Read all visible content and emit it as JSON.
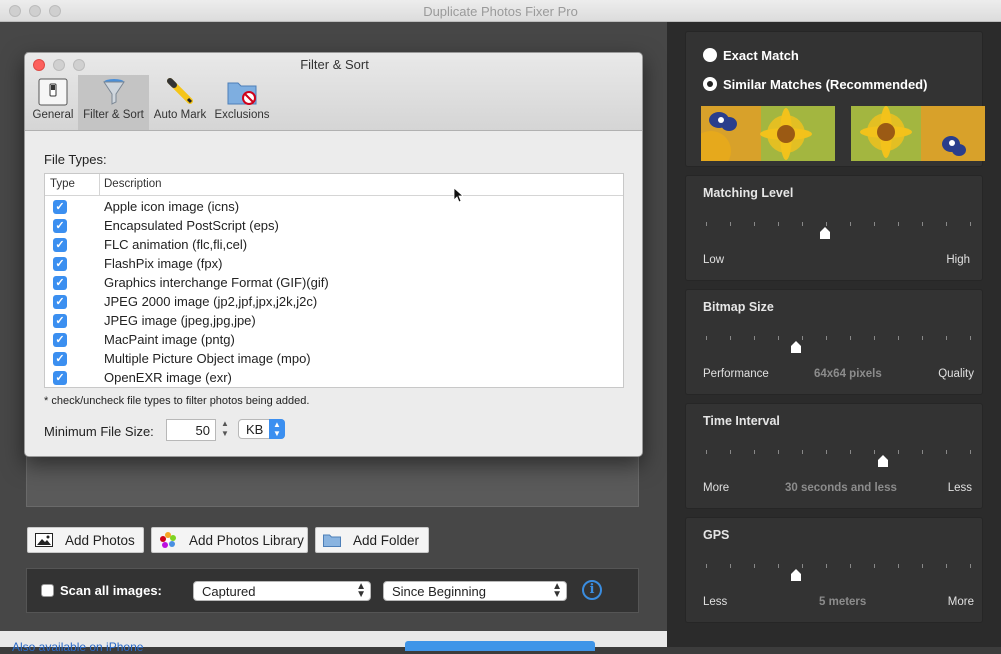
{
  "app": {
    "title": "Duplicate Photos Fixer Pro"
  },
  "dialog": {
    "title": "Filter & Sort",
    "tabs": [
      "General",
      "Filter & Sort",
      "Auto Mark",
      "Exclusions"
    ],
    "file_types_label": "File Types:",
    "columns": [
      "Type",
      "Description"
    ],
    "rows": [
      "Apple icon image (icns)",
      "Encapsulated PostScript (eps)",
      "FLC animation (flc,fli,cel)",
      "FlashPix image (fpx)",
      "Graphics interchange Format (GIF)(gif)",
      "JPEG 2000 image (jp2,jpf,jpx,j2k,j2c)",
      "JPEG image (jpeg,jpg,jpe)",
      "MacPaint image (pntg)",
      "Multiple Picture Object image (mpo)",
      "OpenEXR image (exr)"
    ],
    "note": "* check/uncheck file types to filter photos being added.",
    "min_size_label": "Minimum File Size:",
    "min_size_value": "50",
    "min_size_unit": "KB"
  },
  "left": {
    "add_photos": "Add Photos",
    "add_library": "Add Photos Library",
    "add_folder": "Add Folder",
    "scan_all": "Scan all images:",
    "captured": "Captured",
    "since": "Since Beginning",
    "info": "i",
    "also": "Also available on iPhone"
  },
  "right": {
    "exact": "Exact Match",
    "similar": "Similar Matches (Recommended)",
    "matching": {
      "title": "Matching Level",
      "left": "Low",
      "mid": "",
      "right": "High",
      "level": 0.45
    },
    "bitmap": {
      "title": "Bitmap Size",
      "left": "Performance",
      "mid": "64x64 pixels",
      "right": "Quality",
      "level": 0.34
    },
    "time": {
      "title": "Time Interval",
      "left": "More",
      "mid": "30 seconds and less",
      "right": "Less",
      "level": 0.67
    },
    "gps": {
      "title": "GPS",
      "left": "Less",
      "mid": "5 meters",
      "right": "More",
      "level": 0.34
    }
  }
}
